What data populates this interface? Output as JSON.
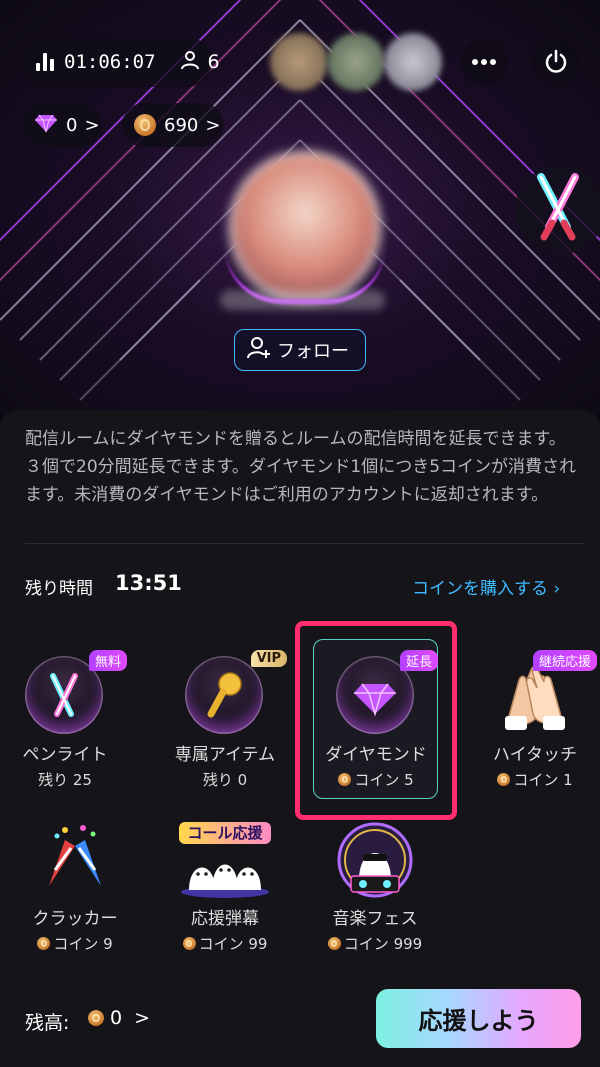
{
  "header": {
    "live_time": "01:06:07",
    "viewer_count": "6",
    "diamond_count": "0",
    "coin_count": "690",
    "chevron": ">"
  },
  "profile": {
    "follow_label": "フォロー"
  },
  "info": {
    "description": "配信ルームにダイヤモンドを贈るとルームの配信時間を延長できます。３個で20分間延長できます。ダイヤモンド1個につき5コインが消費されます。未消費のダイヤモンドはご利用のアカウントに返却されます。"
  },
  "remaining": {
    "label": "残り時間",
    "time": "13:51"
  },
  "buy_coins": "コインを購入する ›",
  "items": [
    {
      "name": "ペンライト",
      "sub": "残り 25",
      "badge": "無料"
    },
    {
      "name": "専属アイテム",
      "sub": "残り 0",
      "badge": "VIP"
    },
    {
      "name": "ダイヤモンド",
      "sub": "コイン 5",
      "badge": "延長"
    },
    {
      "name": "ハイタッチ",
      "sub": "コイン 1",
      "badge": "継続応援"
    },
    {
      "name": "クラッカー",
      "sub": "コイン 9"
    },
    {
      "name": "応援弾幕",
      "sub": "コイン 99",
      "banner": "コール応援"
    },
    {
      "name": "音楽フェス",
      "sub": "コイン 999"
    }
  ],
  "footer": {
    "balance_label": "残高:",
    "balance_value": "0",
    "cheer_button": "応援しよう"
  },
  "colors": {
    "accent_blue": "#3fb9ff",
    "highlight_pink": "#ff2e6e",
    "badge_purple": "#c040ff"
  }
}
